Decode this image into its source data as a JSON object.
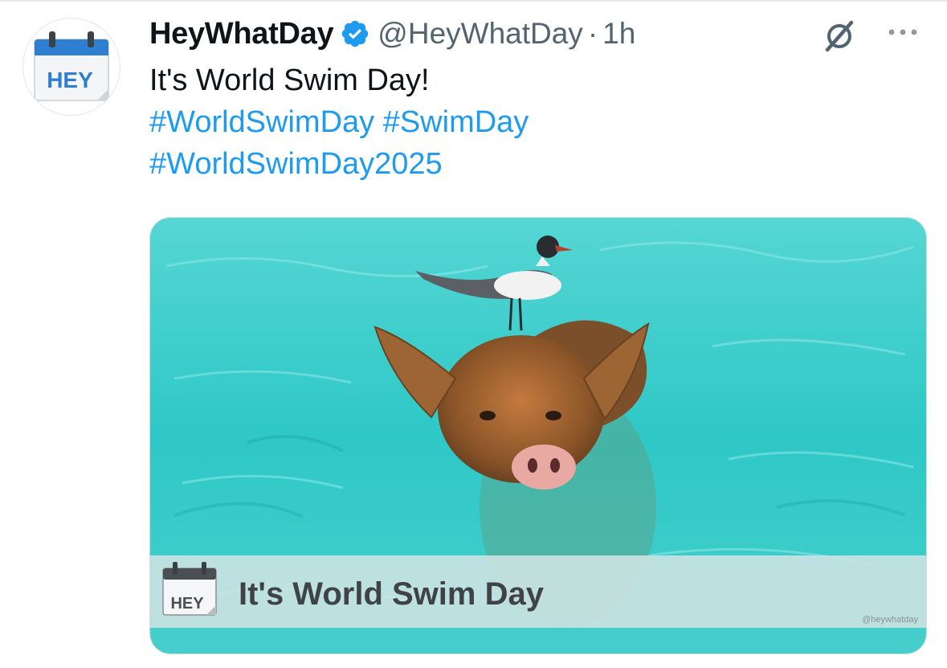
{
  "author": {
    "display_name": "HeyWhatDay",
    "handle": "@HeyWhatDay",
    "separator": "·",
    "time": "1h",
    "avatar_text": "HEY",
    "verified": true
  },
  "tweet": {
    "text": "It's World Swim Day!",
    "hashtags": [
      "#WorldSwimDay",
      "#SwimDay",
      "#WorldSwimDay2025"
    ]
  },
  "media": {
    "caption_logo_text": "HEY",
    "caption": "It's World Swim Day",
    "watermark": "@heywhatday"
  },
  "icons": {
    "verified": "verified-badge-icon",
    "grok": "grok-icon",
    "more": "more-options-icon"
  },
  "colors": {
    "accent": "#1d9bf0",
    "secondary_text": "#536471",
    "water": "#3ccfcf"
  }
}
